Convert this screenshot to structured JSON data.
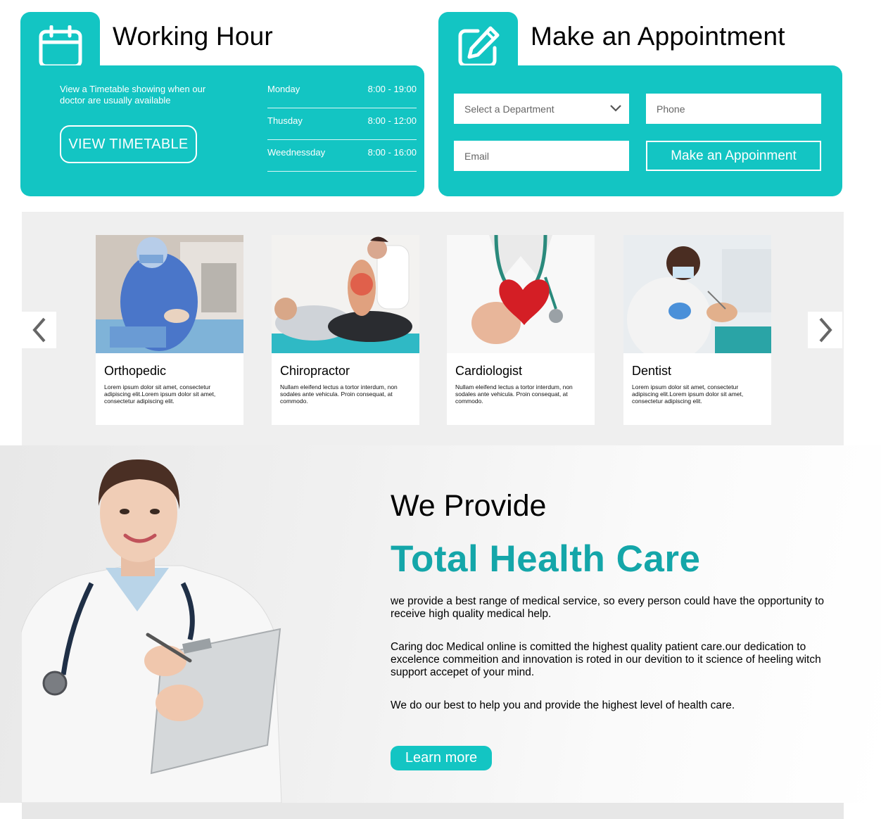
{
  "working_hour": {
    "title": "Working Hour",
    "icon": "calendar-icon",
    "description": "View a Timetable showing when our doctor are usually available",
    "button_label": "VIEW TIMETABLE",
    "schedule": [
      {
        "day": "Monday",
        "time": "8:00 - 19:00"
      },
      {
        "day": "Thusday",
        "time": "8:00 - 12:00"
      },
      {
        "day": "Weednessday",
        "time": "8:00 - 16:00"
      }
    ]
  },
  "appointment": {
    "title": "Make an Appointment",
    "icon": "edit-icon",
    "department_select": {
      "value": "Select a Department"
    },
    "phone_placeholder": "Phone",
    "email_placeholder": "Email",
    "submit_label": "Make an Appoinment"
  },
  "departments": [
    {
      "name": "Orthopedic",
      "text": "Lorem ipsum dolor sit amet, consectetur adipiscing elit.Lorem ipsum dolor sit amet, consectetur adipiscing elit."
    },
    {
      "name": "Chiropractor",
      "text": "Nullam eleifend lectus a tortor interdum, non sodales ante vehicula. Proin consequat, at commodo."
    },
    {
      "name": "Cardiologist",
      "text": "Nullam eleifend lectus a tortor interdum, non sodales ante vehicula. Proin consequat, at commodo."
    },
    {
      "name": "Dentist",
      "text": "Lorem ipsum dolor sit amet, consectetur adipiscing elit.Lorem ipsum dolor sit amet, consectetur adipiscing elit."
    }
  ],
  "carousel": {
    "prev_icon": "chevron-left-icon",
    "next_icon": "chevron-right-icon"
  },
  "hero": {
    "subtitle": "We Provide",
    "title": "Total Health Care",
    "paragraphs": [
      "we provide a best range of medical service, so every person could have the opportunity  to receive high quality medical help.",
      "Caring doc Medical online is comitted the highest quality patient care.our dedication to excelence commeition and innovation is roted in our devition to it science of heeling witch support accepet of your mind.",
      "We do our best to help you and provide the highest level of health care."
    ],
    "button_label": "Learn more"
  },
  "colors": {
    "accent": "#13c5c3",
    "title_teal": "#14a6a9",
    "section_gray": "#efefef"
  }
}
